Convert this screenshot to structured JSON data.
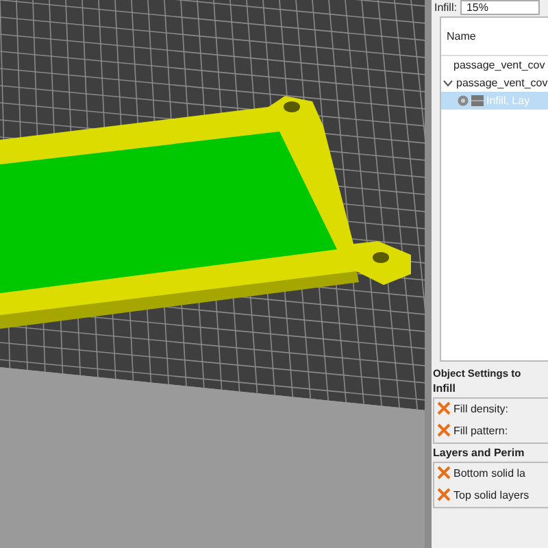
{
  "infill": {
    "label": "Infill:",
    "value": "15%"
  },
  "object_list": {
    "columns": [
      "Name"
    ],
    "items": [
      {
        "label": "passage_vent_cov",
        "selected": false
      },
      {
        "label": "passage_vent_cov",
        "selected": false,
        "expanded": true,
        "children": [
          {
            "label": "Infill, Lay",
            "selected": true
          }
        ]
      }
    ]
  },
  "object_settings": {
    "title": "Object Settings to",
    "groups": [
      {
        "title": "Infill",
        "options": [
          "Fill density:",
          "Fill pattern:"
        ]
      },
      {
        "title": "Layers and Perim",
        "options": [
          "Bottom solid la",
          "Top solid layers"
        ]
      }
    ]
  }
}
